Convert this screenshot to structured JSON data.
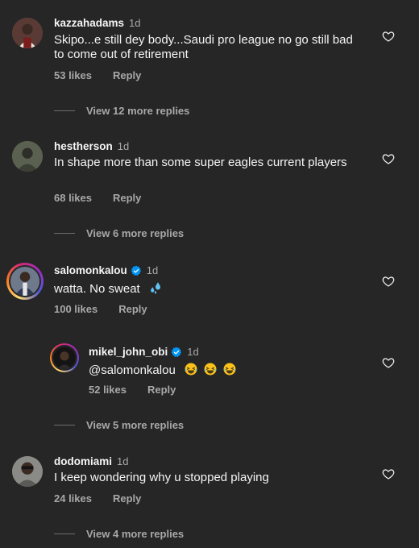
{
  "comments": [
    {
      "username": "kazzahadams",
      "time": "1d",
      "text": "Skipo...e still dey body...Saudi pro league no go still bad to come out of retirement",
      "likes": "53 likes",
      "reply": "Reply",
      "view_replies": "View 12 more replies"
    },
    {
      "username": "hestherson",
      "time": "1d",
      "text": "In shape more than some super eagles current players",
      "likes": "68 likes",
      "reply": "Reply",
      "view_replies": "View 6 more replies"
    },
    {
      "username": "salomonkalou",
      "time": "1d",
      "text": "watta. No sweat",
      "likes": "100 likes",
      "reply": "Reply",
      "verified": true,
      "emoji": "sweat-droplets-icon"
    },
    {
      "username": "mikel_john_obi",
      "time": "1d",
      "text": "@salomonkalou",
      "likes": "52 likes",
      "reply": "Reply",
      "verified": true,
      "emoji": "laughing-face-icon",
      "view_replies": "View 5 more replies"
    },
    {
      "username": "dodomiami",
      "time": "1d",
      "text": "I keep wondering why u stopped playing",
      "likes": "24 likes",
      "reply": "Reply",
      "view_replies": "View 4 more replies"
    }
  ],
  "colors": {
    "background": "#262626",
    "primary_text": "#f5f5f5",
    "secondary_text": "#a8a8a8",
    "verified_badge": "#0095f6"
  }
}
